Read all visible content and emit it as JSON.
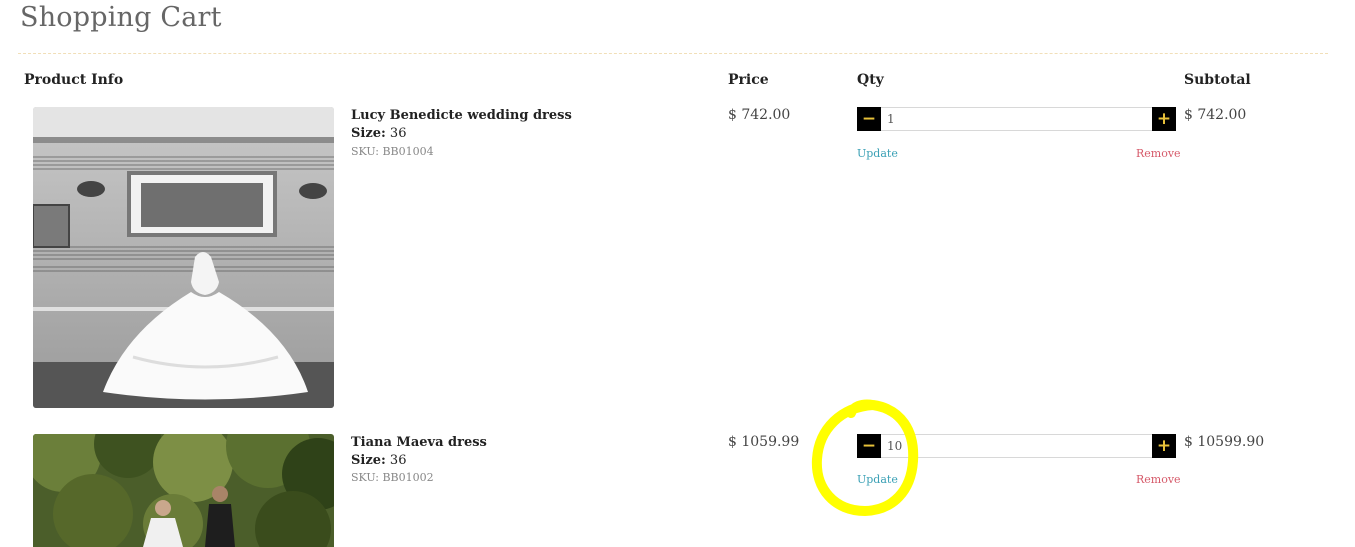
{
  "page": {
    "title": "Shopping Cart"
  },
  "table": {
    "headers": {
      "product": "Product Info",
      "price": "Price",
      "qty": "Qty",
      "subtotal": "Subtotal"
    }
  },
  "items": [
    {
      "name": "Lucy Benedicte wedding dress",
      "size_label": "Size:",
      "size_value": "36",
      "sku": "SKU: BB01004",
      "price": "$ 742.00",
      "qty": "1",
      "subtotal": "$ 742.00",
      "update_label": "Update",
      "remove_label": "Remove",
      "minus_label": "−",
      "plus_label": "+"
    },
    {
      "name": "Tiana Maeva dress",
      "size_label": "Size:",
      "size_value": "36",
      "sku": "SKU: BB01002",
      "price": "$ 1059.99",
      "qty": "10",
      "subtotal": "$ 10599.90",
      "update_label": "Update",
      "remove_label": "Remove",
      "minus_label": "−",
      "plus_label": "+"
    }
  ],
  "colors": {
    "accent_gold": "#e8c23a",
    "update_link": "#3aa0b5",
    "remove_link": "#d65a6a",
    "highlight": "#ffff00"
  }
}
